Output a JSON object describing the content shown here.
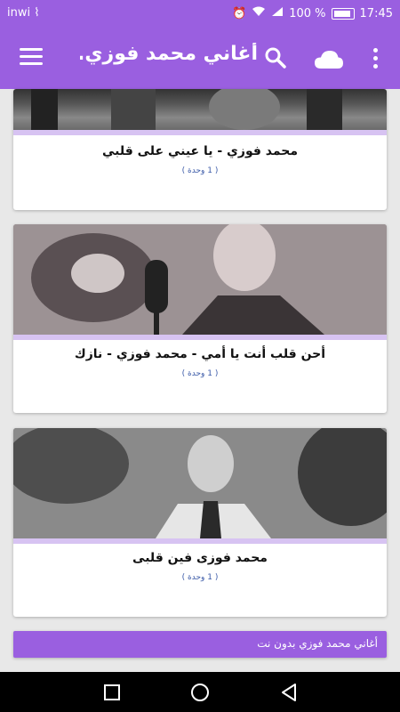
{
  "status_bar": {
    "carrier": "inwi",
    "battery": "100 %",
    "time": "17:45"
  },
  "app_bar": {
    "title": "أغاني محمد فوزي..."
  },
  "items": [
    {
      "title": "محمد فوزي - يا عيني على قلبي",
      "count": "( 1 وحدة )"
    },
    {
      "title": "أحن قلب أنت يا أمي - محمد فوزي - نازك",
      "count": "( 1 وحدة )"
    },
    {
      "title": "محمد فوزى فين قلبى",
      "count": "( 1 وحدة )"
    }
  ],
  "banner": {
    "text": "أغاني محمد فوزي بدون نت"
  },
  "colors": {
    "primary": "#9a5fe0",
    "accent_line": "#d7c3f2",
    "count_text": "#3b5aa8"
  }
}
